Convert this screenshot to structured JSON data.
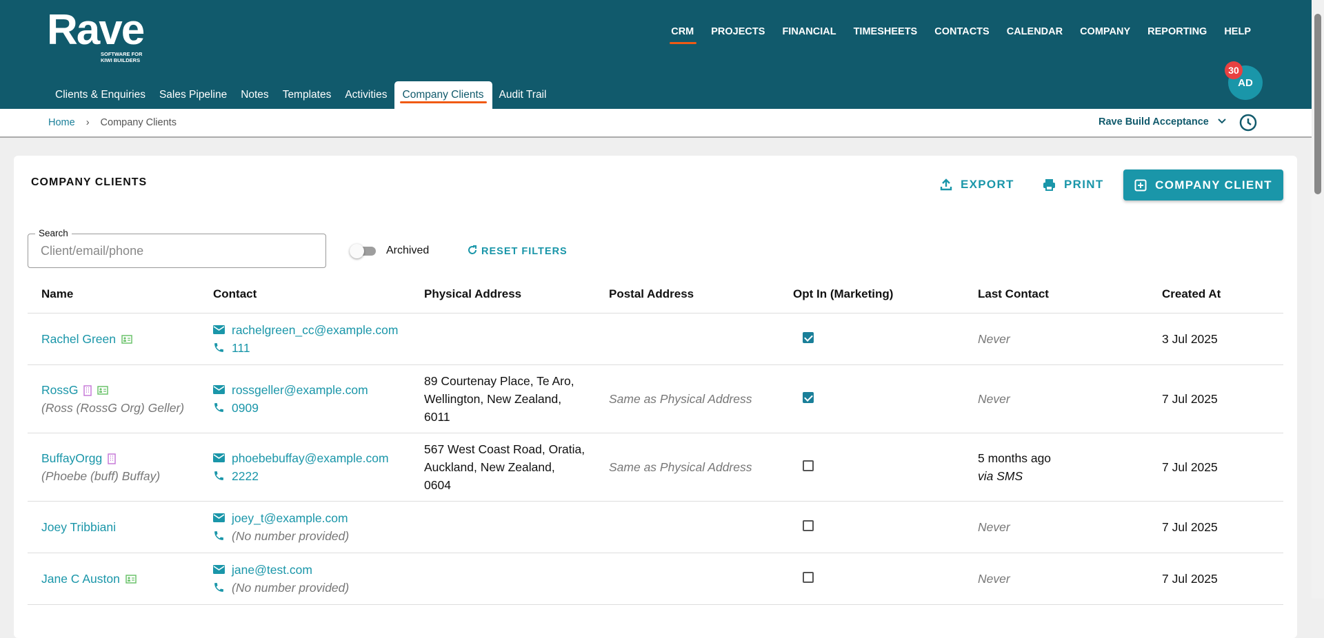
{
  "logo": {
    "name": "Rave",
    "tagline1": "SOFTWARE FOR",
    "tagline2": "KIWI BUILDERS"
  },
  "topnav": [
    "CRM",
    "PROJECTS",
    "FINANCIAL",
    "TIMESHEETS",
    "CONTACTS",
    "CALENDAR",
    "COMPANY",
    "REPORTING",
    "HELP"
  ],
  "tabs": [
    "Clients & Enquiries",
    "Sales Pipeline",
    "Notes",
    "Templates",
    "Activities",
    "Company Clients",
    "Audit Trail"
  ],
  "user": {
    "initials": "AD",
    "notifications": "30"
  },
  "breadcrumb": {
    "home": "Home",
    "sep": "›",
    "current": "Company Clients"
  },
  "org": "Rave Build Acceptance",
  "page": {
    "title": "COMPANY CLIENTS",
    "export": "EXPORT",
    "print": "PRINT",
    "add": "COMPANY CLIENT"
  },
  "filters": {
    "search_label": "Search",
    "search_placeholder": "Client/email/phone",
    "archived": "Archived",
    "reset": "RESET FILTERS"
  },
  "columns": [
    "Name",
    "Contact",
    "Physical Address",
    "Postal Address",
    "Opt In (Marketing)",
    "Last Contact",
    "Created At"
  ],
  "rows": [
    {
      "name": "Rachel Green",
      "sub": "",
      "email": "rachelgreen_cc@example.com",
      "phone": "111",
      "physical": [
        "",
        "",
        ""
      ],
      "postal": "",
      "optin": true,
      "last": "Never",
      "via": "",
      "created": "3 Jul 2025"
    },
    {
      "name": "RossG",
      "sub": "(Ross (RossG Org) Geller)",
      "email": "rossgeller@example.com",
      "phone": "0909",
      "physical": [
        "89 Courtenay Place, Te Aro,",
        "Wellington, New Zealand,",
        "6011"
      ],
      "postal": "Same as Physical Address",
      "optin": true,
      "last": "Never",
      "via": "",
      "created": "7 Jul 2025"
    },
    {
      "name": "BuffayOrgg",
      "sub": "(Phoebe (buff) Buffay)",
      "email": "phoebebuffay@example.com",
      "phone": "2222",
      "physical": [
        "567 West Coast Road, Oratia,",
        "Auckland, New Zealand,",
        "0604"
      ],
      "postal": "Same as Physical Address",
      "optin": false,
      "last": "5 months ago",
      "via": "via SMS",
      "created": "7 Jul 2025"
    },
    {
      "name": "Joey Tribbiani",
      "sub": "",
      "email": "joey_t@example.com",
      "phone": "(No number provided)",
      "physical": [
        "",
        "",
        ""
      ],
      "postal": "",
      "optin": false,
      "last": "Never",
      "via": "",
      "created": "7 Jul 2025"
    },
    {
      "name": "Jane C Auston",
      "sub": "",
      "email": "jane@test.com",
      "phone": "(No number provided)",
      "physical": [
        "",
        "",
        ""
      ],
      "postal": "",
      "optin": false,
      "last": "Never",
      "via": "",
      "created": "7 Jul 2025"
    }
  ],
  "colors": {
    "header": "#115a6c",
    "accent": "#1a96a9",
    "underline": "#f05a14",
    "badge": "#e84141"
  }
}
